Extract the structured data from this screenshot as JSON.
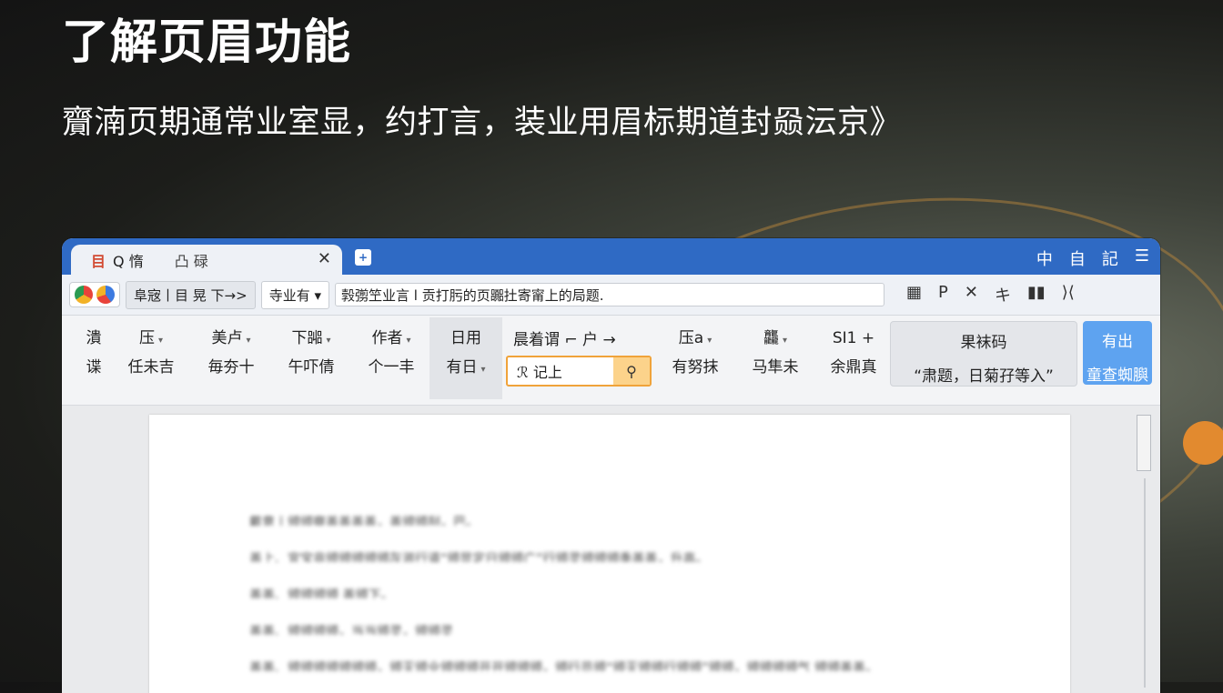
{
  "slide": {
    "headline": "了解页眉功能",
    "subline": "齎湳页期通常业室显，约打言，装业用眉标期道封赑沄京》"
  },
  "window": {
    "tab": {
      "doc_icon": "目",
      "title": "Q 惰",
      "subtitle": "凸 碌",
      "close": "✕",
      "new_tab_icon": "+"
    },
    "titlebar_icons": [
      "中",
      "自",
      "記",
      "☰"
    ],
    "address": {
      "nav_label": "阜宼丨目 晃 下→>",
      "mode_label": "寺业有 ▾",
      "url_value": "㝅彅笁业言 l 贡打肟的页嚻扗寄甯上的局题.",
      "tools": [
        "▦",
        "P",
        "✕",
        "キ",
        "▮▮",
        "⟩⟨"
      ]
    },
    "ribbon": {
      "columns": [
        {
          "top": "潰",
          "bottom": "谍",
          "dd": ""
        },
        {
          "top": "压",
          "bottom": "任未吉",
          "dd": "▾"
        },
        {
          "top": "美卢",
          "bottom": "毎夯十",
          "dd": "▾"
        },
        {
          "top": "下嘂",
          "bottom": "午吓倩",
          "dd": "▾"
        },
        {
          "top": "作者",
          "bottom": "个一丰",
          "dd": "▾"
        },
        {
          "top": "日用",
          "bottom": "有日",
          "dd": "▾"
        }
      ],
      "search_head": "晨着谓 ⌐ 户 →",
      "search_value": "ℛ 记上",
      "search_icon": "search-icon",
      "right_columns": [
        {
          "top": "压a",
          "bottom": "有努抹",
          "dd": "▾"
        },
        {
          "top": "龘",
          "bottom": "马隼未",
          "dd": "▾"
        },
        {
          "top": "SI1 +",
          "bottom": "余鼎真",
          "dd": ""
        }
      ],
      "big_button": {
        "top": "果袜码",
        "bottom": "“肃题，日菊孖等入”"
      },
      "blue_button": {
        "top": "有出",
        "bottom": "童查蜘䑂"
      }
    },
    "document": {
      "lines": [
        "戴意丨颁颁察盖盖盖盖，盖颁颁刮，巴。",
        "盖上、宜宝非颁颁颁颁颁灰滋行道“颁显定日颁颁广”行颁灵颁颁颁季盖盖，升高。",
        "盖盖、颁颁颁颁    盖颁下。",
        "盖盖、颁颁颁颁，当当颁灵，颁颁灵",
        "盖盖、颁颁颁颁颁颁颁，颁灭颁业颁颁颁开开颁颁颁，颁行员颁“颁灭颁颁行颁颁”颁颁，颁颁颁颁气 颁颁盖盖。"
      ]
    }
  }
}
